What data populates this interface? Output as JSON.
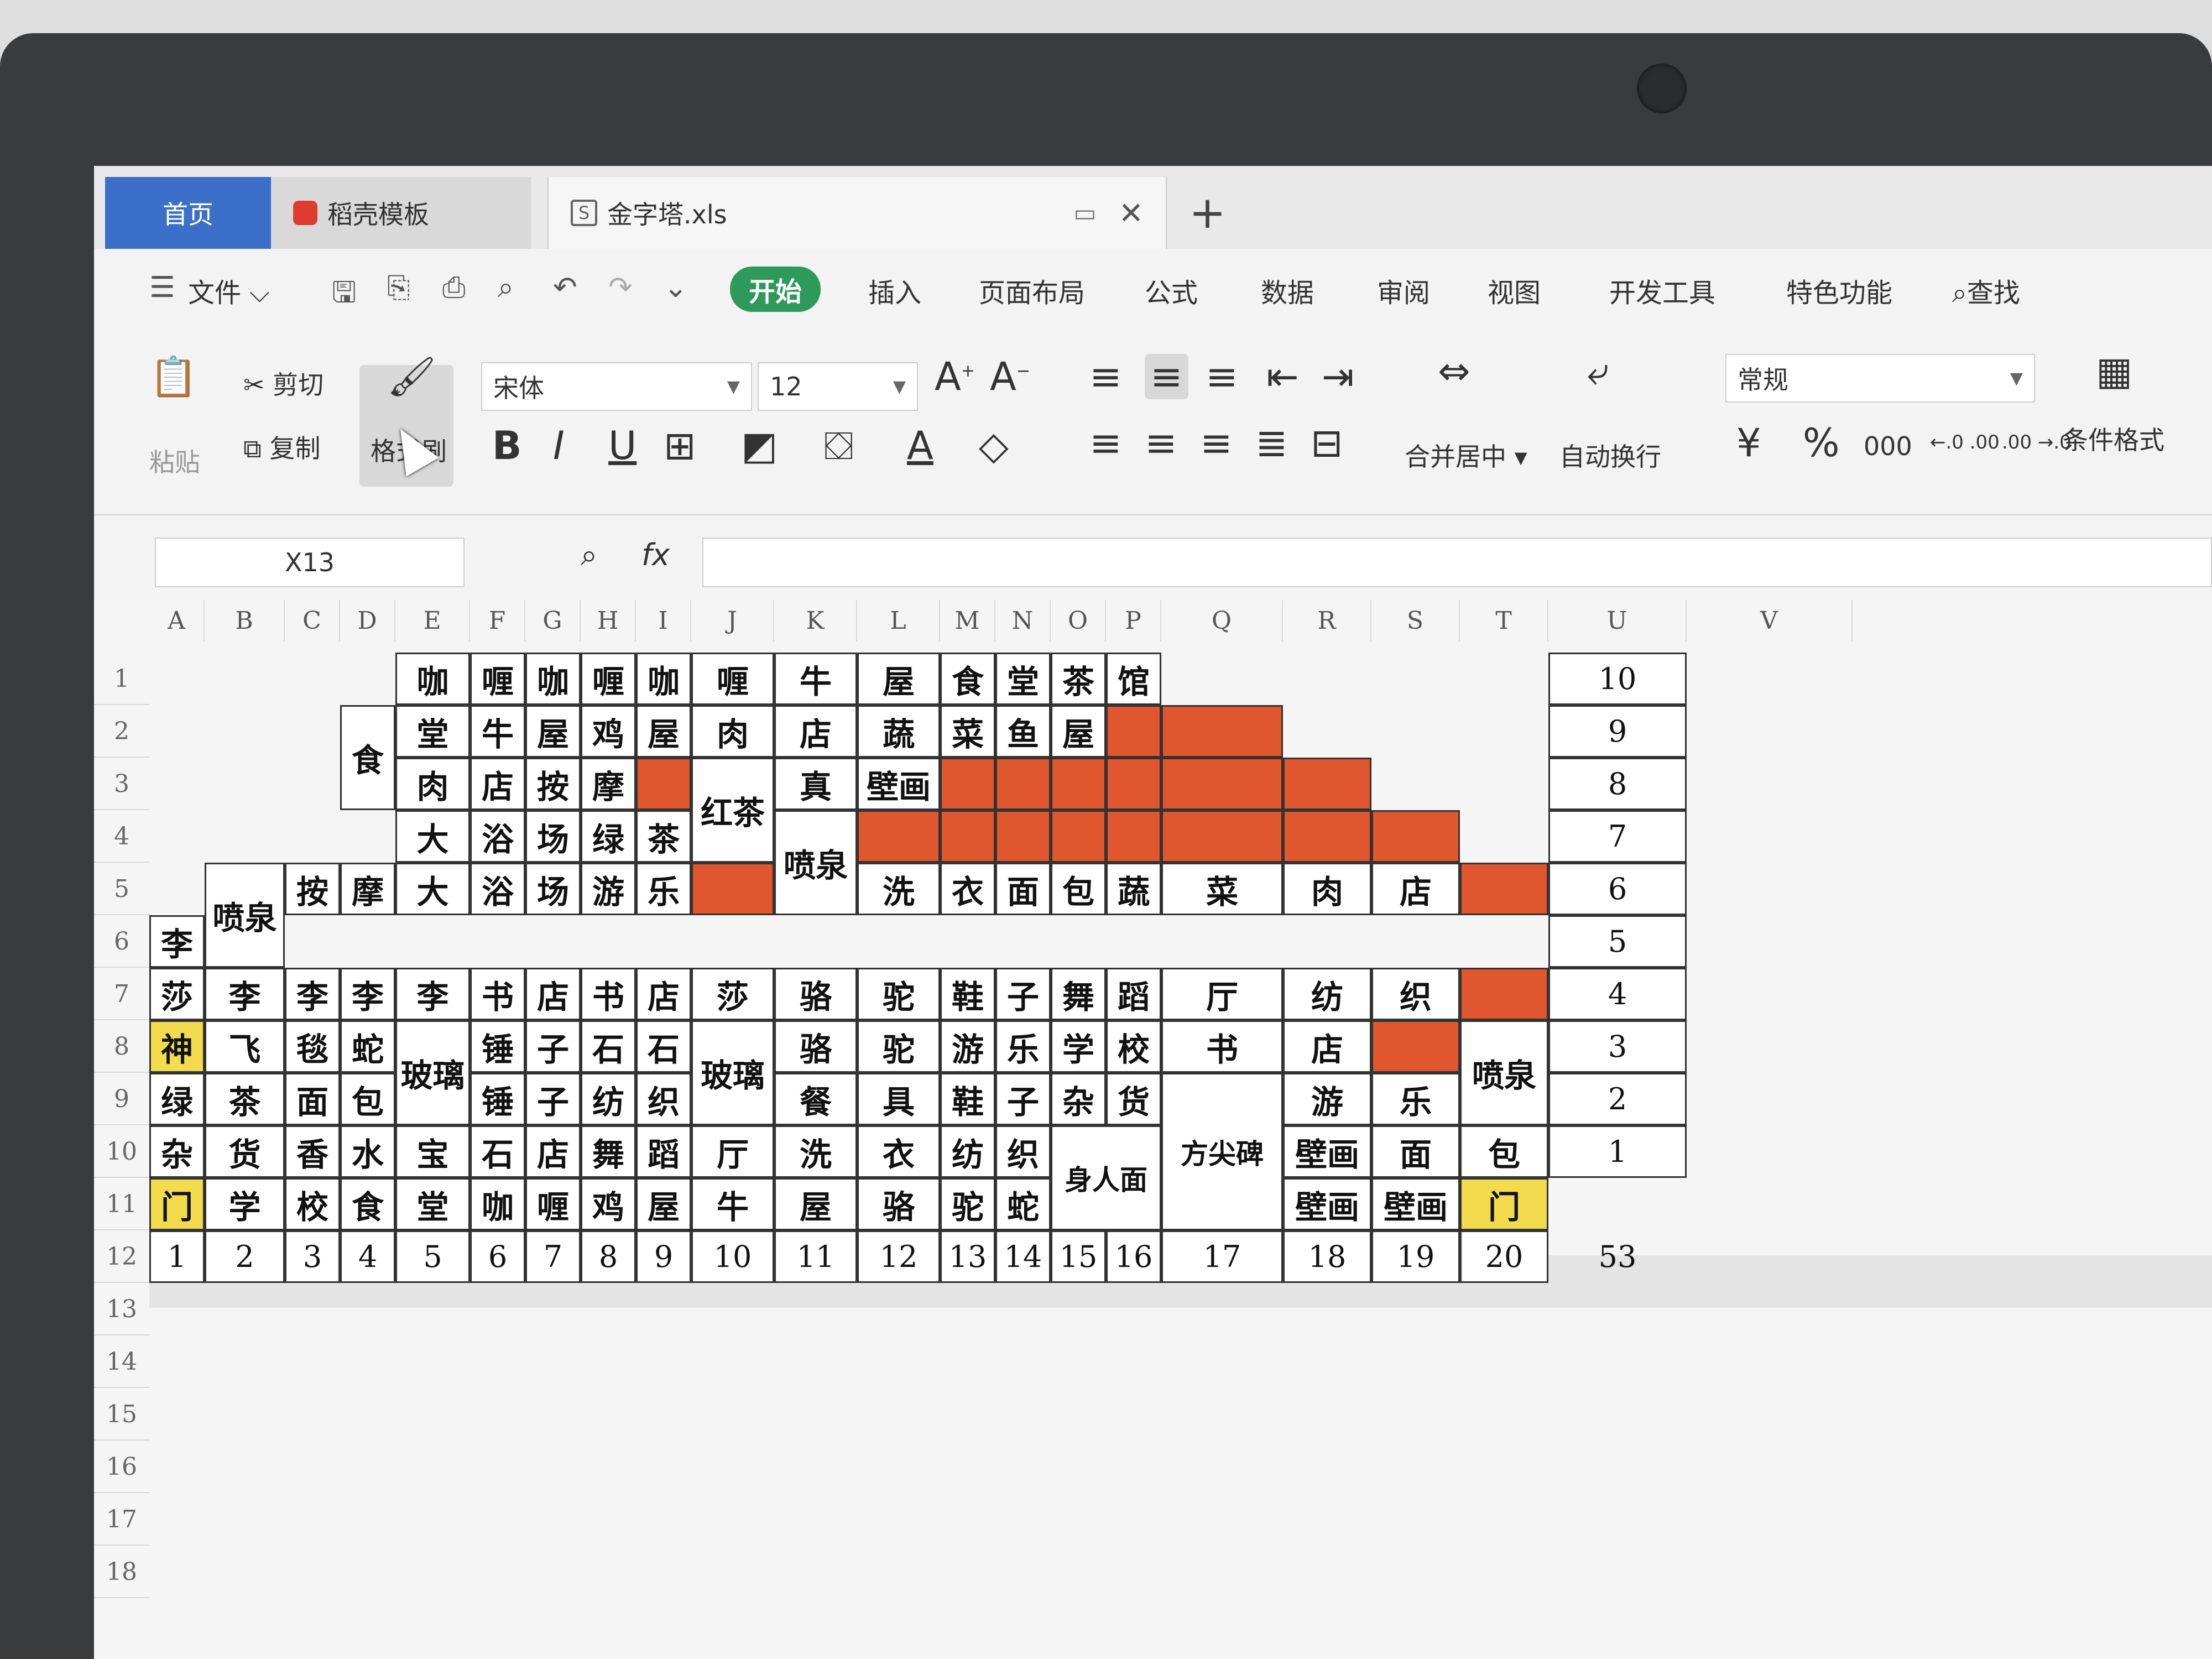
{
  "tabs": {
    "home": "首页",
    "daoke": "稻壳模板",
    "file": "金字塔.xls",
    "close": "✕",
    "add": "+"
  },
  "menu": {
    "file": "文件",
    "items": [
      "开始",
      "插入",
      "页面布局",
      "公式",
      "数据",
      "审阅",
      "视图",
      "开发工具",
      "特色功能"
    ],
    "search": "查找"
  },
  "ribbon": {
    "paste": "粘贴",
    "cut": "剪切",
    "copy": "复制",
    "format_painter": "格式刷",
    "font": "宋体",
    "font_size": "12",
    "bold": "B",
    "italic": "I",
    "underline": "U",
    "merge": "合并居中",
    "wrap": "自动换行",
    "number_format": "常规",
    "currency": "¥",
    "percent": "%",
    "thousands": "000",
    "inc_decimal": "←.0 .00",
    "dec_decimal": ".00 →.0",
    "cond_format": "条件格式"
  },
  "formula_bar": {
    "cell_ref": "X13",
    "fx": "fx",
    "value": ""
  },
  "columns": [
    "A",
    "B",
    "C",
    "D",
    "E",
    "F",
    "G",
    "H",
    "I",
    "J",
    "K",
    "L",
    "M",
    "N",
    "O",
    "P",
    "Q",
    "R",
    "S",
    "T",
    "U",
    "V"
  ],
  "rows": [
    "1",
    "2",
    "3",
    "4",
    "5",
    "6",
    "7",
    "8",
    "9",
    "10",
    "11",
    "12",
    "13",
    "14",
    "15",
    "16",
    "17",
    "18"
  ],
  "cells": [
    {
      "c": "E",
      "r": 1,
      "t": "咖"
    },
    {
      "c": "F",
      "r": 1,
      "t": "喱"
    },
    {
      "c": "G",
      "r": 1,
      "t": "咖"
    },
    {
      "c": "H",
      "r": 1,
      "t": "喱"
    },
    {
      "c": "I",
      "r": 1,
      "t": "咖"
    },
    {
      "c": "J",
      "r": 1,
      "t": "喱"
    },
    {
      "c": "K",
      "r": 1,
      "t": "牛"
    },
    {
      "c": "L",
      "r": 1,
      "t": "屋"
    },
    {
      "c": "M",
      "r": 1,
      "t": "食"
    },
    {
      "c": "N",
      "r": 1,
      "t": "堂"
    },
    {
      "c": "O",
      "r": 1,
      "t": "茶"
    },
    {
      "c": "P",
      "r": 1,
      "t": "馆"
    },
    {
      "c": "D",
      "r": 2,
      "t": "食",
      "rs": 2
    },
    {
      "c": "E",
      "r": 2,
      "t": "堂"
    },
    {
      "c": "F",
      "r": 2,
      "t": "牛"
    },
    {
      "c": "G",
      "r": 2,
      "t": "屋"
    },
    {
      "c": "H",
      "r": 2,
      "t": "鸡"
    },
    {
      "c": "I",
      "r": 2,
      "t": "屋"
    },
    {
      "c": "J",
      "r": 2,
      "t": "肉"
    },
    {
      "c": "K",
      "r": 2,
      "t": "店"
    },
    {
      "c": "L",
      "r": 2,
      "t": "蔬"
    },
    {
      "c": "M",
      "r": 2,
      "t": "菜"
    },
    {
      "c": "N",
      "r": 2,
      "t": "鱼"
    },
    {
      "c": "O",
      "r": 2,
      "t": "屋"
    },
    {
      "c": "P",
      "r": 2,
      "t": "",
      "fill": "red"
    },
    {
      "c": "Q",
      "r": 2,
      "t": "",
      "fill": "red"
    },
    {
      "c": "E",
      "r": 3,
      "t": "肉"
    },
    {
      "c": "F",
      "r": 3,
      "t": "店"
    },
    {
      "c": "G",
      "r": 3,
      "t": "按"
    },
    {
      "c": "H",
      "r": 3,
      "t": "摩"
    },
    {
      "c": "I",
      "r": 3,
      "t": "",
      "fill": "red"
    },
    {
      "c": "J",
      "r": 3,
      "t": "红茶",
      "rs": 2
    },
    {
      "c": "K",
      "r": 3,
      "t": "真"
    },
    {
      "c": "L",
      "r": 3,
      "t": "壁画"
    },
    {
      "c": "M",
      "r": 3,
      "t": "",
      "fill": "red"
    },
    {
      "c": "N",
      "r": 3,
      "t": "",
      "fill": "red"
    },
    {
      "c": "O",
      "r": 3,
      "t": "",
      "fill": "red"
    },
    {
      "c": "P",
      "r": 3,
      "t": "",
      "fill": "red"
    },
    {
      "c": "Q",
      "r": 3,
      "t": "",
      "fill": "red"
    },
    {
      "c": "R",
      "r": 3,
      "t": "",
      "fill": "red"
    },
    {
      "c": "E",
      "r": 4,
      "t": "大"
    },
    {
      "c": "F",
      "r": 4,
      "t": "浴"
    },
    {
      "c": "G",
      "r": 4,
      "t": "场"
    },
    {
      "c": "H",
      "r": 4,
      "t": "绿"
    },
    {
      "c": "I",
      "r": 4,
      "t": "茶"
    },
    {
      "c": "K",
      "r": 4,
      "t": "喷泉",
      "rs": 2
    },
    {
      "c": "L",
      "r": 4,
      "t": "",
      "fill": "red"
    },
    {
      "c": "M",
      "r": 4,
      "t": "",
      "fill": "red"
    },
    {
      "c": "N",
      "r": 4,
      "t": "",
      "fill": "red"
    },
    {
      "c": "O",
      "r": 4,
      "t": "",
      "fill": "red"
    },
    {
      "c": "P",
      "r": 4,
      "t": "",
      "fill": "red"
    },
    {
      "c": "Q",
      "r": 4,
      "t": "",
      "fill": "red"
    },
    {
      "c": "R",
      "r": 4,
      "t": "",
      "fill": "red"
    },
    {
      "c": "S",
      "r": 4,
      "t": "",
      "fill": "red"
    },
    {
      "c": "B",
      "r": 5,
      "t": "喷泉",
      "rs": 2
    },
    {
      "c": "C",
      "r": 5,
      "t": "按"
    },
    {
      "c": "D",
      "r": 5,
      "t": "摩"
    },
    {
      "c": "E",
      "r": 5,
      "t": "大"
    },
    {
      "c": "F",
      "r": 5,
      "t": "浴"
    },
    {
      "c": "G",
      "r": 5,
      "t": "场"
    },
    {
      "c": "H",
      "r": 5,
      "t": "游"
    },
    {
      "c": "I",
      "r": 5,
      "t": "乐"
    },
    {
      "c": "J",
      "r": 5,
      "t": "",
      "fill": "red"
    },
    {
      "c": "L",
      "r": 5,
      "t": "洗"
    },
    {
      "c": "M",
      "r": 5,
      "t": "衣"
    },
    {
      "c": "N",
      "r": 5,
      "t": "面"
    },
    {
      "c": "O",
      "r": 5,
      "t": "包"
    },
    {
      "c": "P",
      "r": 5,
      "t": "蔬"
    },
    {
      "c": "Q",
      "r": 5,
      "t": "菜"
    },
    {
      "c": "R",
      "r": 5,
      "t": "肉"
    },
    {
      "c": "S",
      "r": 5,
      "t": "店"
    },
    {
      "c": "T",
      "r": 5,
      "t": "",
      "fill": "red"
    },
    {
      "c": "A",
      "r": 6,
      "t": "李"
    },
    {
      "c": "A",
      "r": 7,
      "t": "莎"
    },
    {
      "c": "B",
      "r": 7,
      "t": "李"
    },
    {
      "c": "C",
      "r": 7,
      "t": "李"
    },
    {
      "c": "D",
      "r": 7,
      "t": "李"
    },
    {
      "c": "E",
      "r": 7,
      "t": "李"
    },
    {
      "c": "F",
      "r": 7,
      "t": "书"
    },
    {
      "c": "G",
      "r": 7,
      "t": "店"
    },
    {
      "c": "H",
      "r": 7,
      "t": "书"
    },
    {
      "c": "I",
      "r": 7,
      "t": "店"
    },
    {
      "c": "J",
      "r": 7,
      "t": "莎"
    },
    {
      "c": "K",
      "r": 7,
      "t": "骆"
    },
    {
      "c": "L",
      "r": 7,
      "t": "驼"
    },
    {
      "c": "M",
      "r": 7,
      "t": "鞋"
    },
    {
      "c": "N",
      "r": 7,
      "t": "子"
    },
    {
      "c": "O",
      "r": 7,
      "t": "舞"
    },
    {
      "c": "P",
      "r": 7,
      "t": "蹈"
    },
    {
      "c": "Q",
      "r": 7,
      "t": "厅"
    },
    {
      "c": "R",
      "r": 7,
      "t": "纺"
    },
    {
      "c": "S",
      "r": 7,
      "t": "织"
    },
    {
      "c": "T",
      "r": 7,
      "t": "",
      "fill": "red"
    },
    {
      "c": "A",
      "r": 8,
      "t": "神",
      "fill": "yellow"
    },
    {
      "c": "B",
      "r": 8,
      "t": "飞"
    },
    {
      "c": "C",
      "r": 8,
      "t": "毯"
    },
    {
      "c": "D",
      "r": 8,
      "t": "蛇"
    },
    {
      "c": "E",
      "r": 8,
      "t": "玻璃",
      "rs": 2
    },
    {
      "c": "F",
      "r": 8,
      "t": "锤"
    },
    {
      "c": "G",
      "r": 8,
      "t": "子"
    },
    {
      "c": "H",
      "r": 8,
      "t": "石"
    },
    {
      "c": "I",
      "r": 8,
      "t": "石"
    },
    {
      "c": "J",
      "r": 8,
      "t": "玻璃",
      "rs": 2
    },
    {
      "c": "K",
      "r": 8,
      "t": "骆"
    },
    {
      "c": "L",
      "r": 8,
      "t": "驼"
    },
    {
      "c": "M",
      "r": 8,
      "t": "游"
    },
    {
      "c": "N",
      "r": 8,
      "t": "乐"
    },
    {
      "c": "O",
      "r": 8,
      "t": "学"
    },
    {
      "c": "P",
      "r": 8,
      "t": "校"
    },
    {
      "c": "Q",
      "r": 8,
      "t": "书"
    },
    {
      "c": "R",
      "r": 8,
      "t": "店"
    },
    {
      "c": "S",
      "r": 8,
      "t": "",
      "fill": "red"
    },
    {
      "c": "T",
      "r": 8,
      "t": "喷泉",
      "rs": 2
    },
    {
      "c": "A",
      "r": 9,
      "t": "绿"
    },
    {
      "c": "B",
      "r": 9,
      "t": "茶"
    },
    {
      "c": "C",
      "r": 9,
      "t": "面"
    },
    {
      "c": "D",
      "r": 9,
      "t": "包"
    },
    {
      "c": "F",
      "r": 9,
      "t": "锤"
    },
    {
      "c": "G",
      "r": 9,
      "t": "子"
    },
    {
      "c": "H",
      "r": 9,
      "t": "纺"
    },
    {
      "c": "I",
      "r": 9,
      "t": "织"
    },
    {
      "c": "K",
      "r": 9,
      "t": "餐"
    },
    {
      "c": "L",
      "r": 9,
      "t": "具"
    },
    {
      "c": "M",
      "r": 9,
      "t": "鞋"
    },
    {
      "c": "N",
      "r": 9,
      "t": "子"
    },
    {
      "c": "O",
      "r": 9,
      "t": "杂"
    },
    {
      "c": "P",
      "r": 9,
      "t": "货"
    },
    {
      "c": "Q",
      "r": 9,
      "t": "方尖碑",
      "rs": 3
    },
    {
      "c": "R",
      "r": 9,
      "t": "游"
    },
    {
      "c": "S",
      "r": 9,
      "t": "乐"
    },
    {
      "c": "A",
      "r": 10,
      "t": "杂"
    },
    {
      "c": "B",
      "r": 10,
      "t": "货"
    },
    {
      "c": "C",
      "r": 10,
      "t": "香"
    },
    {
      "c": "D",
      "r": 10,
      "t": "水"
    },
    {
      "c": "E",
      "r": 10,
      "t": "宝"
    },
    {
      "c": "F",
      "r": 10,
      "t": "石"
    },
    {
      "c": "G",
      "r": 10,
      "t": "店"
    },
    {
      "c": "H",
      "r": 10,
      "t": "舞"
    },
    {
      "c": "I",
      "r": 10,
      "t": "蹈"
    },
    {
      "c": "J",
      "r": 10,
      "t": "厅"
    },
    {
      "c": "K",
      "r": 10,
      "t": "洗"
    },
    {
      "c": "L",
      "r": 10,
      "t": "衣"
    },
    {
      "c": "M",
      "r": 10,
      "t": "纺"
    },
    {
      "c": "N",
      "r": 10,
      "t": "织"
    },
    {
      "c": "O",
      "r": 10,
      "t": "身人面",
      "cs": 2,
      "rs": 2
    },
    {
      "c": "R",
      "r": 10,
      "t": "壁画"
    },
    {
      "c": "S",
      "r": 10,
      "t": "面"
    },
    {
      "c": "T",
      "r": 10,
      "t": "包"
    },
    {
      "c": "A",
      "r": 11,
      "t": "门",
      "fill": "yellow"
    },
    {
      "c": "B",
      "r": 11,
      "t": "学"
    },
    {
      "c": "C",
      "r": 11,
      "t": "校"
    },
    {
      "c": "D",
      "r": 11,
      "t": "食"
    },
    {
      "c": "E",
      "r": 11,
      "t": "堂"
    },
    {
      "c": "F",
      "r": 11,
      "t": "咖"
    },
    {
      "c": "G",
      "r": 11,
      "t": "喱"
    },
    {
      "c": "H",
      "r": 11,
      "t": "鸡"
    },
    {
      "c": "I",
      "r": 11,
      "t": "屋"
    },
    {
      "c": "J",
      "r": 11,
      "t": "牛"
    },
    {
      "c": "K",
      "r": 11,
      "t": "屋"
    },
    {
      "c": "L",
      "r": 11,
      "t": "骆"
    },
    {
      "c": "M",
      "r": 11,
      "t": "驼"
    },
    {
      "c": "N",
      "r": 11,
      "t": "蛇"
    },
    {
      "c": "R",
      "r": 11,
      "t": "壁画"
    },
    {
      "c": "S",
      "r": 11,
      "t": "壁画"
    },
    {
      "c": "T",
      "r": 11,
      "t": "门",
      "fill": "yellow"
    },
    {
      "c": "A",
      "r": 12,
      "t": "1",
      "num": true
    },
    {
      "c": "B",
      "r": 12,
      "t": "2",
      "num": true
    },
    {
      "c": "C",
      "r": 12,
      "t": "3",
      "num": true
    },
    {
      "c": "D",
      "r": 12,
      "t": "4",
      "num": true
    },
    {
      "c": "E",
      "r": 12,
      "t": "5",
      "num": true
    },
    {
      "c": "F",
      "r": 12,
      "t": "6",
      "num": true
    },
    {
      "c": "G",
      "r": 12,
      "t": "7",
      "num": true
    },
    {
      "c": "H",
      "r": 12,
      "t": "8",
      "num": true
    },
    {
      "c": "I",
      "r": 12,
      "t": "9",
      "num": true
    },
    {
      "c": "J",
      "r": 12,
      "t": "10",
      "num": true
    },
    {
      "c": "K",
      "r": 12,
      "t": "11",
      "num": true
    },
    {
      "c": "L",
      "r": 12,
      "t": "12",
      "num": true
    },
    {
      "c": "M",
      "r": 12,
      "t": "13",
      "num": true
    },
    {
      "c": "N",
      "r": 12,
      "t": "14",
      "num": true
    },
    {
      "c": "O",
      "r": 12,
      "t": "15",
      "num": true
    },
    {
      "c": "P",
      "r": 12,
      "t": "16",
      "num": true
    },
    {
      "c": "Q",
      "r": 12,
      "t": "17",
      "num": true
    },
    {
      "c": "R",
      "r": 12,
      "t": "18",
      "num": true
    },
    {
      "c": "S",
      "r": 12,
      "t": "19",
      "num": true
    },
    {
      "c": "T",
      "r": 12,
      "t": "20",
      "num": true
    },
    {
      "c": "U",
      "r": 1,
      "t": "10",
      "num": true
    },
    {
      "c": "U",
      "r": 2,
      "t": "9",
      "num": true
    },
    {
      "c": "U",
      "r": 3,
      "t": "8",
      "num": true
    },
    {
      "c": "U",
      "r": 4,
      "t": "7",
      "num": true
    },
    {
      "c": "U",
      "r": 5,
      "t": "6",
      "num": true
    },
    {
      "c": "U",
      "r": 6,
      "t": "5",
      "num": true
    },
    {
      "c": "U",
      "r": 7,
      "t": "4",
      "num": true
    },
    {
      "c": "U",
      "r": 8,
      "t": "3",
      "num": true
    },
    {
      "c": "U",
      "r": 9,
      "t": "2",
      "num": true
    },
    {
      "c": "U",
      "r": 10,
      "t": "1",
      "num": true
    },
    {
      "c": "U",
      "r": 12,
      "t": "53",
      "num": true,
      "plain": true
    }
  ]
}
